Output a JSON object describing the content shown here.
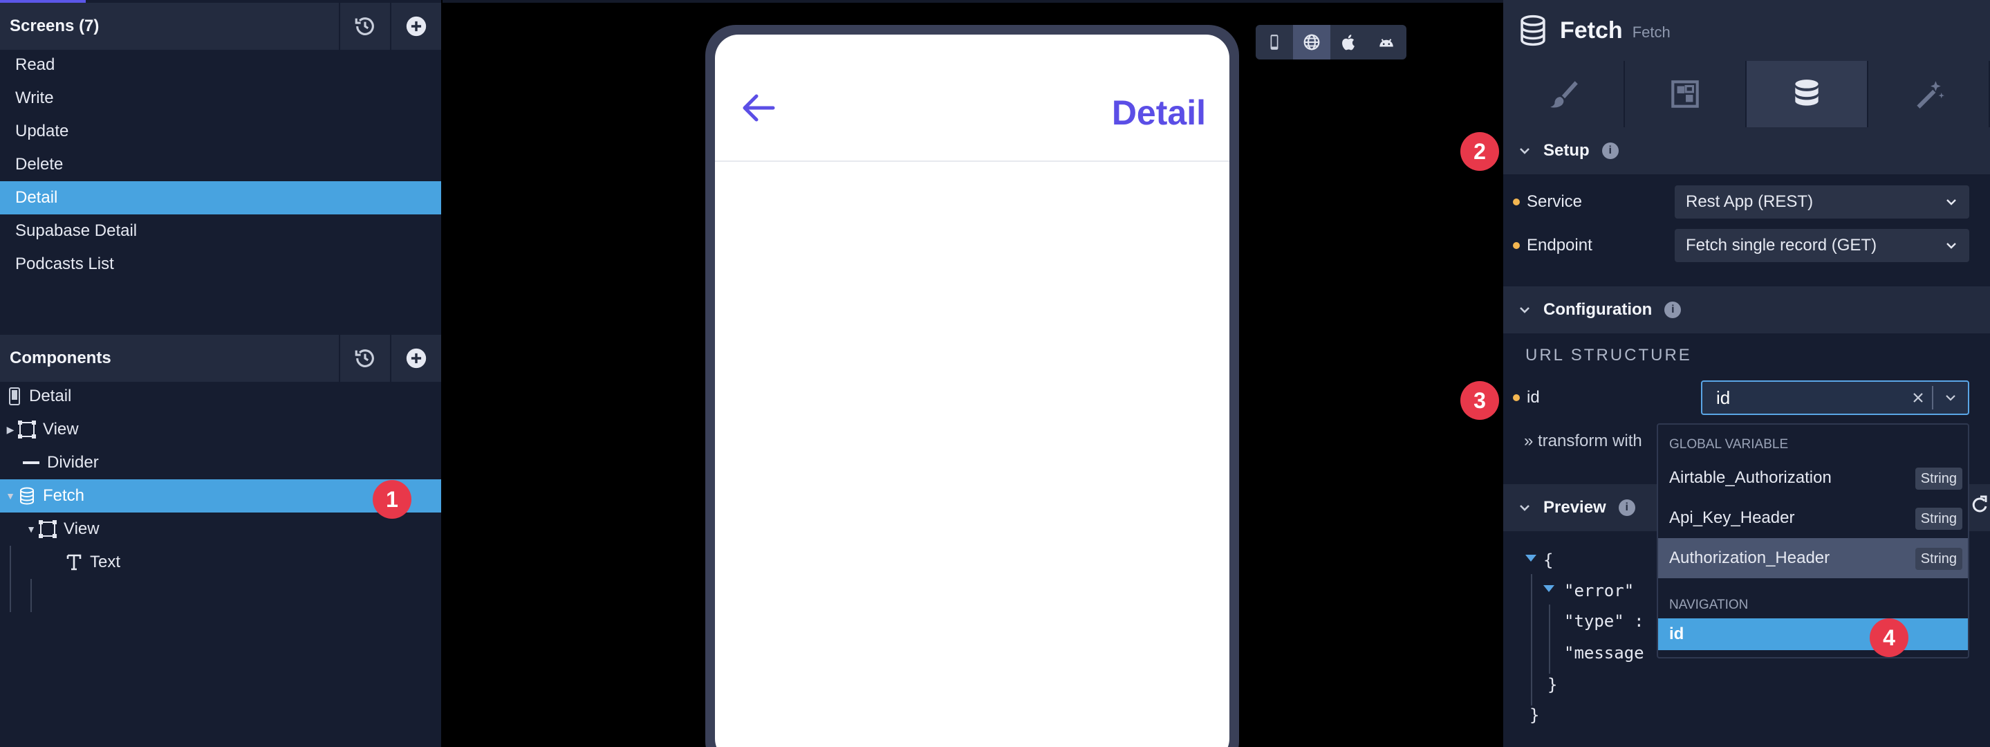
{
  "screens_panel": {
    "title": "Screens (7)",
    "items": [
      "Read",
      "Write",
      "Update",
      "Delete",
      "Detail",
      "Supabase Detail",
      "Podcasts List"
    ],
    "selected_index": 4
  },
  "components_panel": {
    "title": "Components",
    "tree": [
      {
        "label": "Detail",
        "icon": "phone-icon",
        "depth": 0,
        "caret": ""
      },
      {
        "label": "View",
        "icon": "view-frame-icon",
        "depth": 0,
        "caret": "right"
      },
      {
        "label": "Divider",
        "icon": "divider-icon",
        "depth": 0,
        "caret": ""
      },
      {
        "label": "Fetch",
        "icon": "database-icon",
        "depth": 0,
        "caret": "down",
        "selected": true
      },
      {
        "label": "View",
        "icon": "view-frame-icon",
        "depth": 1,
        "caret": "down"
      },
      {
        "label": "Text",
        "icon": "text-icon",
        "depth": 2,
        "caret": ""
      }
    ]
  },
  "badges": [
    "1",
    "2",
    "3",
    "4"
  ],
  "phone": {
    "title": "Detail"
  },
  "device_toggles": [
    "phone-icon",
    "globe-icon",
    "apple-icon",
    "android-icon"
  ],
  "inspector": {
    "name": "Fetch",
    "subtitle": "Fetch",
    "tabs": [
      "brush-icon",
      "layout-icon",
      "database-icon",
      "magic-wand-icon"
    ],
    "active_tab": 2,
    "setup": {
      "title": "Setup",
      "service_label": "Service",
      "service_value": "Rest App (REST)",
      "endpoint_label": "Endpoint",
      "endpoint_value": "Fetch single record (GET)"
    },
    "configuration": {
      "title": "Configuration",
      "url_structure_label": "URL STRUCTURE",
      "id_label": "id",
      "id_value": "id",
      "transform_label": "» transform with"
    },
    "dropdown": {
      "group_global": "GLOBAL VARIABLE",
      "global_items": [
        {
          "label": "Airtable_Authorization",
          "type": "String"
        },
        {
          "label": "Api_Key_Header",
          "type": "String"
        },
        {
          "label": "Authorization_Header",
          "type": "String"
        }
      ],
      "group_nav": "NAVIGATION",
      "nav_items": [
        {
          "label": "id"
        }
      ]
    },
    "preview": {
      "title": "Preview",
      "json_lines": [
        "{",
        "\"error\"",
        "\"type\" :",
        "\"message",
        "}",
        "}"
      ]
    }
  },
  "colors": {
    "accent": "#5b4ee6",
    "selection": "#48a3e0",
    "badge": "#e8384a",
    "required_dot": "#f3b651"
  }
}
